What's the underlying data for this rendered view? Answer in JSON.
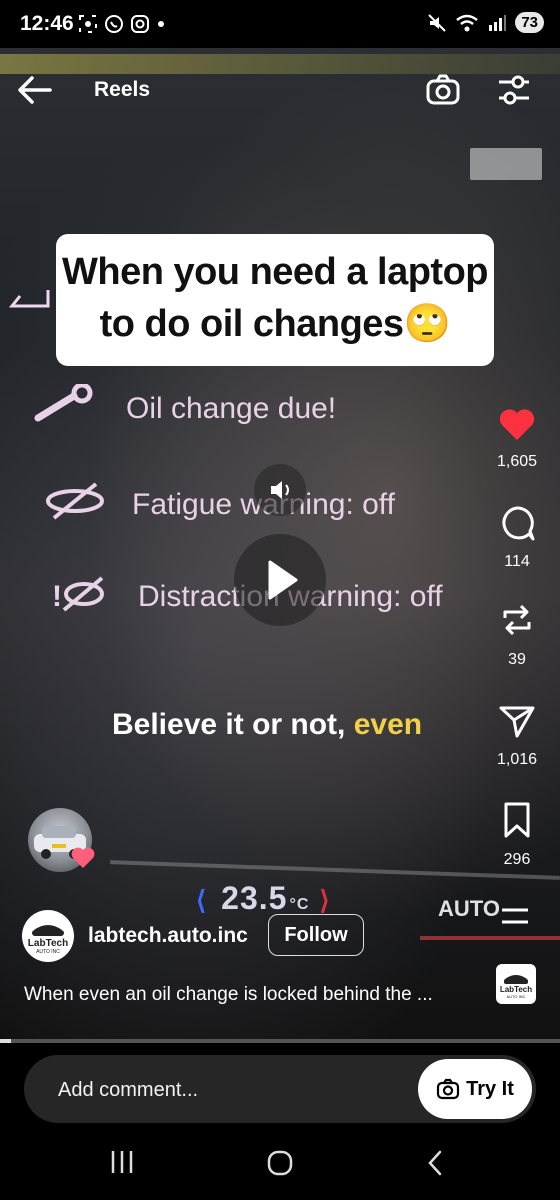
{
  "status_bar": {
    "time": "12:46",
    "battery": "73"
  },
  "header": {
    "title": "Reels"
  },
  "overlay": {
    "caption_line1": "When you need a laptop",
    "caption_line2": "to do oil changes",
    "caption_emoji": "🙄",
    "dash_items": [
      "Oil change due!",
      "Fatigue warning: off",
      "Distraction warning: off"
    ],
    "subtitle_plain": "Believe it or not,",
    "subtitle_highlight": "even",
    "speed": "23.5",
    "speed_unit": "°C",
    "climate_mode": "AUTO"
  },
  "actions": {
    "likes": "1,605",
    "comments": "114",
    "reposts": "39",
    "shares": "1,016",
    "saves": "296"
  },
  "post": {
    "author": "labtech.auto.inc",
    "follow_label": "Follow",
    "description": "When even an oil change is locked behind the ...",
    "logo_text": "LabTech",
    "logo_subtext": "AUTO INC"
  },
  "composer": {
    "placeholder": "Add comment...",
    "try_it_label": "Try It"
  },
  "playback": {
    "progress": 0.02
  },
  "colors": {
    "accent_like": "#ff3040",
    "subtitle_highlight": "#f2d14a"
  },
  "icons": [
    "back-arrow-icon",
    "camera-icon",
    "filter-icon",
    "heart-icon",
    "comment-icon",
    "repost-icon",
    "share-icon",
    "bookmark-icon",
    "sound-icon",
    "play-icon",
    "camera-small-icon",
    "recents-icon",
    "home-icon",
    "nav-back-icon"
  ]
}
